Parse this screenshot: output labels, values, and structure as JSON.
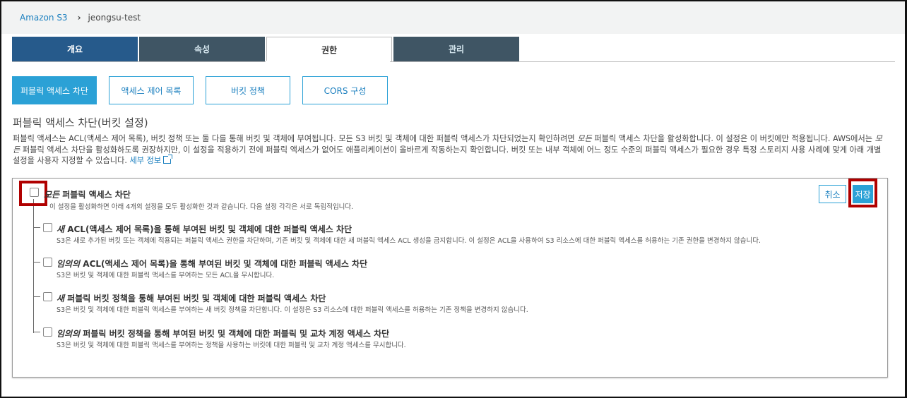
{
  "breadcrumb": {
    "root": "Amazon S3",
    "separator": "›",
    "current": "jeongsu-test"
  },
  "tabs": [
    {
      "label": "개요"
    },
    {
      "label": "속성"
    },
    {
      "label": "권한"
    },
    {
      "label": "관리"
    }
  ],
  "subtabs": [
    {
      "label": "퍼블릭 액세스 차단"
    },
    {
      "label": "액세스 제어 목록"
    },
    {
      "label": "버킷 정책"
    },
    {
      "label": "CORS 구성"
    }
  ],
  "section": {
    "title": "퍼블릭 액세스 차단(버킷 설정)",
    "desc_p1": "퍼블릭 액세스는 ACL(액세스 제어 목록), 버킷 정책 또는 둘 다를 통해 버킷 및 객체에 부여됩니다. 모든 S3 버킷 및 객체에 대한 퍼블릭 액세스가 차단되었는지 확인하려면 ",
    "desc_em1": "모든",
    "desc_p2": " 퍼블릭 액세스 차단을 활성화합니다. 이 설정은 이 버킷에만 적용됩니다. AWS에서는 ",
    "desc_em2": "모든",
    "desc_p3": " 퍼블릭 액세스 차단을 활성화하도록 권장하지만, 이 설정을 적용하기 전에 퍼블릭 액세스가 없어도 애플리케이션이 올바르게 작동하는지 확인합니다. 버킷 또는 내부 객체에 어느 정도 수준의 퍼블릭 액세스가 필요한 경우 특정 스토리지 사용 사례에 맞게 아래 개별 설정을 사용자 지정할 수 있습니다. ",
    "more_link": "세부 정보"
  },
  "panel": {
    "cancel_label": "취소",
    "save_label": "저장",
    "master": {
      "title_em": "모든",
      "title_rest": " 퍼블릭 액세스 차단",
      "desc": "이 설정을 활성화하면 아래 4개의 설정을 모두 활성화한 것과 같습니다. 다음 설정 각각은 서로 독립적입니다."
    },
    "options": [
      {
        "title_em": "새",
        "title_rest": " ACL(액세스 제어 목록)을 통해 부여된 버킷 및 객체에 대한 퍼블릭 액세스 차단",
        "desc": "S3은 새로 추가된 버킷 또는 객체에 적용되는 퍼블릭 액세스 권한을 차단하며, 기존 버킷 및 객체에 대한 새 퍼블릭 액세스 ACL 생성을 금지합니다. 이 설정은 ACL을 사용하여 S3 리소스에 대한 퍼블릭 액세스를 허용하는 기존 권한을 변경하지 않습니다."
      },
      {
        "title_em": "임의의",
        "title_rest": " ACL(액세스 제어 목록)을 통해 부여된 버킷 및 객체에 대한 퍼블릭 액세스 차단",
        "desc": "S3은 버킷 및 객체에 대한 퍼블릭 액세스를 부여하는 모든 ACL을 무시합니다."
      },
      {
        "title_em": "새",
        "title_rest": " 퍼블릭 버킷 정책을 통해 부여된 버킷 및 객체에 대한 퍼블릭 액세스 차단",
        "desc": "S3은 버킷 및 객체에 대한 퍼블릭 액세스를 부여하는 새 버킷 정책을 차단합니다. 이 설정은 S3 리소스에 대한 퍼블릭 액세스를 허용하는 기존 정책을 변경하지 않습니다."
      },
      {
        "title_em": "임의의",
        "title_rest": " 퍼블릭 버킷 정책을 통해 부여된 버킷 및 객체에 대한 퍼블릭 및 교차 계정 액세스 차단",
        "desc": "S3은 버킷 및 객체에 대한 퍼블릭 액세스를 부여하는 정책을 사용하는 버킷에 대한 퍼블릭 및 교차 계정 액세스를 무시합니다."
      }
    ]
  },
  "colors": {
    "accent": "#2ba1d6",
    "tab_active_dark": "#265a8b",
    "tab_dark": "#3f5564",
    "highlight": "#b00000"
  }
}
